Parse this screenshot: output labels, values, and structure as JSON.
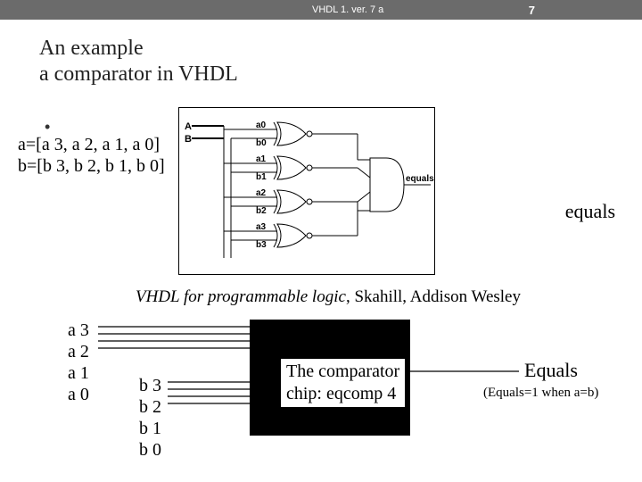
{
  "header": {
    "left": "VHDL 1. ver. 7 a",
    "pageNum": "7"
  },
  "title": {
    "line1": "An example",
    "line2": "a comparator in VHDL"
  },
  "inputs": {
    "a": "a=[a 3, a 2, a 1, a 0]",
    "b": "b=[b 3, b 2, b 1, b 0]"
  },
  "equalsLabel": "equals",
  "caption": {
    "italic": "VHDL for programmable logic",
    "rest": ", Skahill, Addison Wesley"
  },
  "circuit": {
    "busA": "A",
    "busB": "B",
    "bits": [
      "a0",
      "b0",
      "a1",
      "b1",
      "a2",
      "b2",
      "a3",
      "b3"
    ],
    "out": "equals"
  },
  "chip": {
    "line1": "The comparator",
    "line2": "chip: eqcomp 4"
  },
  "signals": {
    "a": [
      "a 3",
      "a 2",
      "a 1",
      "a 0"
    ],
    "b": [
      "b 3",
      "b 2",
      "b 1",
      "b 0"
    ]
  },
  "output": {
    "name": "Equals",
    "note": "(Equals=1 when a=b)"
  }
}
